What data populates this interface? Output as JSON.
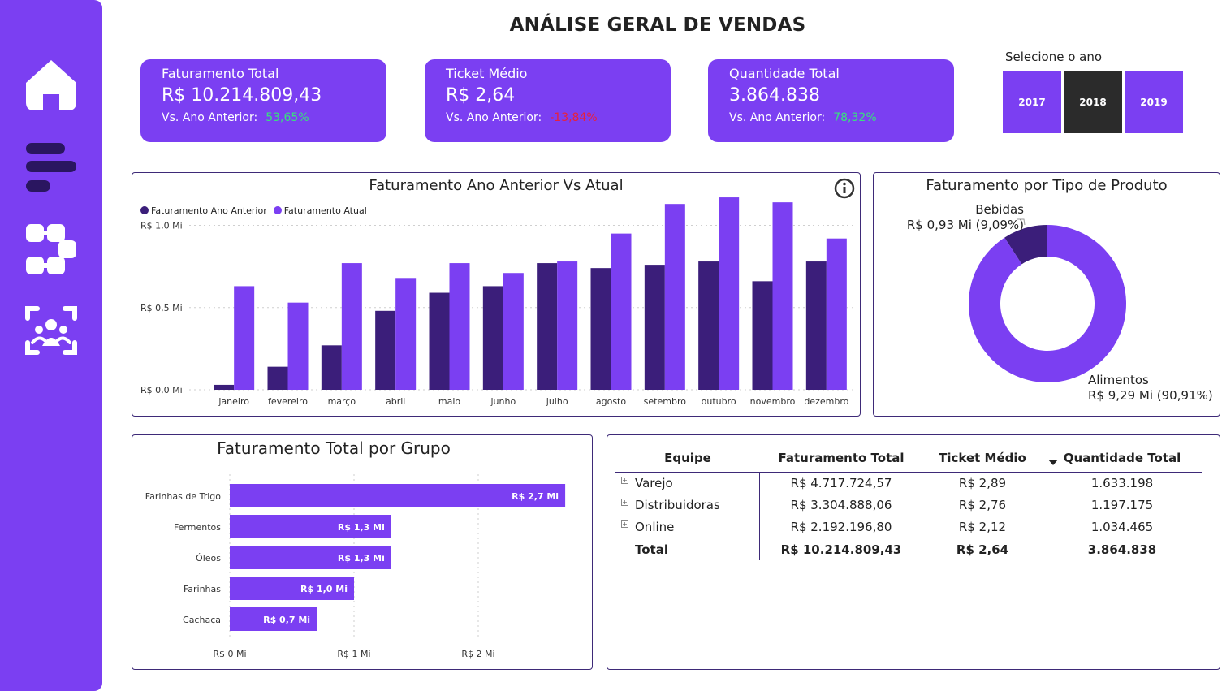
{
  "page_title": "ANÁLISE GERAL DE VENDAS",
  "colors": {
    "accent": "#7B3FF2",
    "dark": "#3B1E7A",
    "positive": "#39E07E",
    "negative": "#E8213B",
    "selected": "#2B2B2B"
  },
  "sidebar": {
    "items": [
      {
        "icon": "home-icon"
      },
      {
        "icon": "bars-icon"
      },
      {
        "icon": "connections-icon"
      },
      {
        "icon": "team-icon"
      }
    ]
  },
  "kpis": [
    {
      "title": "Faturamento Total",
      "value": "R$ 10.214.809,43",
      "sub_label": "Vs. Ano Anterior:",
      "sub_value": "53,65%"
    },
    {
      "title": "Ticket Médio",
      "value": "R$ 2,64",
      "sub_label": "Vs. Ano Anterior:",
      "sub_value": "-13,84%"
    },
    {
      "title": "Quantidade Total",
      "value": "3.864.838",
      "sub_label": "Vs. Ano Anterior:",
      "sub_value": "78,32%"
    }
  ],
  "year_slicer": {
    "label": "Selecione o ano",
    "options": [
      "2017",
      "2018",
      "2019"
    ],
    "selected": "2018"
  },
  "monthly_chart": {
    "title": "Faturamento Ano Anterior Vs Atual",
    "legend": [
      "Faturamento Ano Anterior",
      "Faturamento Atual"
    ],
    "y_ticks": [
      "R$ 1,0 Mi",
      "R$ 0,5 Mi",
      "R$ 0,0 Mi"
    ]
  },
  "donut_chart": {
    "title": "Faturamento por Tipo de Produto",
    "labels": [
      {
        "name": "Bebidas",
        "value": "R$ 0,93 Mi (9,09%)"
      },
      {
        "name": "Alimentos",
        "value": "R$ 9,29 Mi (90,91%)"
      }
    ]
  },
  "group_chart": {
    "title": "Faturamento Total por Grupo",
    "x_ticks": [
      "R$ 0 Mi",
      "R$ 1 Mi",
      "R$ 2 Mi"
    ]
  },
  "table": {
    "headers": [
      "Equipe",
      "Faturamento Total",
      "Ticket Médio",
      "Quantidade Total"
    ],
    "rows": [
      [
        "Varejo",
        "R$ 4.717.724,57",
        "R$ 2,89",
        "1.633.198"
      ],
      [
        "Distribuidoras",
        "R$ 3.304.888,06",
        "R$ 2,76",
        "1.197.175"
      ],
      [
        "Online",
        "R$ 2.192.196,80",
        "R$ 2,12",
        "1.034.465"
      ]
    ],
    "total": [
      "Total",
      "R$ 10.214.809,43",
      "R$ 2,64",
      "3.864.838"
    ]
  },
  "chart_data": [
    {
      "type": "bar",
      "title": "Faturamento Ano Anterior Vs Atual",
      "categories": [
        "janeiro",
        "fevereiro",
        "março",
        "abril",
        "maio",
        "junho",
        "julho",
        "agosto",
        "setembro",
        "outubro",
        "novembro",
        "dezembro"
      ],
      "series": [
        {
          "name": "Faturamento Ano Anterior",
          "values": [
            0.03,
            0.14,
            0.27,
            0.48,
            0.59,
            0.63,
            0.77,
            0.74,
            0.76,
            0.78,
            0.66,
            0.78
          ]
        },
        {
          "name": "Faturamento Atual",
          "values": [
            0.63,
            0.53,
            0.77,
            0.68,
            0.77,
            0.71,
            0.78,
            0.95,
            1.13,
            1.17,
            1.14,
            0.92
          ]
        }
      ],
      "ylim": [
        0,
        1.2
      ],
      "y_ticks": [
        0,
        0.5,
        1.0
      ],
      "grid": true,
      "legend": "top-left"
    },
    {
      "type": "pie",
      "title": "Faturamento por Tipo de Produto",
      "categories": [
        "Bebidas",
        "Alimentos"
      ],
      "values": [
        0.93,
        9.29
      ],
      "percent": [
        9.09,
        90.91
      ],
      "donut": true
    },
    {
      "type": "bar",
      "orientation": "horizontal",
      "title": "Faturamento Total por Grupo",
      "categories": [
        "Farinhas de Trigo",
        "Fermentos",
        "Óleos",
        "Farinhas",
        "Cachaça"
      ],
      "values": [
        2.7,
        1.3,
        1.3,
        1.0,
        0.7
      ],
      "data_labels": [
        "R$ 2,7 Mi",
        "R$ 1,3 Mi",
        "R$ 1,3 Mi",
        "R$ 1,0 Mi",
        "R$ 0,7 Mi"
      ],
      "xlim": [
        0,
        2.8
      ],
      "x_ticks": [
        0,
        1,
        2
      ],
      "grid": true
    }
  ]
}
